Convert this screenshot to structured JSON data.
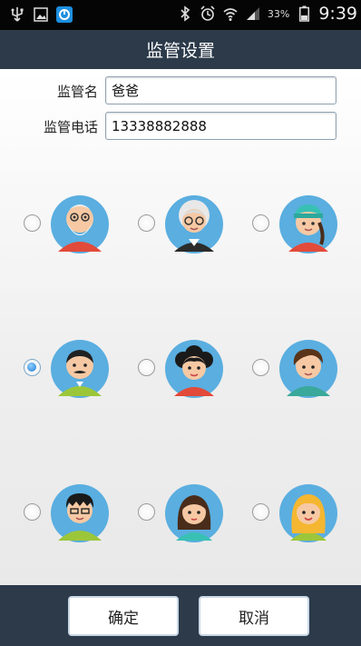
{
  "status_bar": {
    "icons": [
      "usb-icon",
      "image-icon",
      "app-icon",
      "bluetooth-icon",
      "alarm-icon",
      "wifi-icon",
      "signal-icon",
      "battery-icon"
    ],
    "battery_percent": "33%",
    "time": "9:39"
  },
  "title": "监管设置",
  "form": {
    "name_label": "监管名",
    "name_value": "爸爸",
    "phone_label": "监管电话",
    "phone_value": "13338882888"
  },
  "avatars": {
    "selected_index": 3,
    "items": [
      "grandpa-avatar",
      "grandma-avatar",
      "girl-headscarf-avatar",
      "father-avatar",
      "mother-avatar",
      "boy-avatar",
      "boy-glasses-avatar",
      "girl-avatar",
      "blonde-girl-avatar"
    ]
  },
  "buttons": {
    "confirm": "确定",
    "cancel": "取消"
  },
  "colors": {
    "title_bar": "#2c3a4a",
    "avatar_bg": "#5aaee0",
    "radio_checked": "#1d7bd1"
  }
}
